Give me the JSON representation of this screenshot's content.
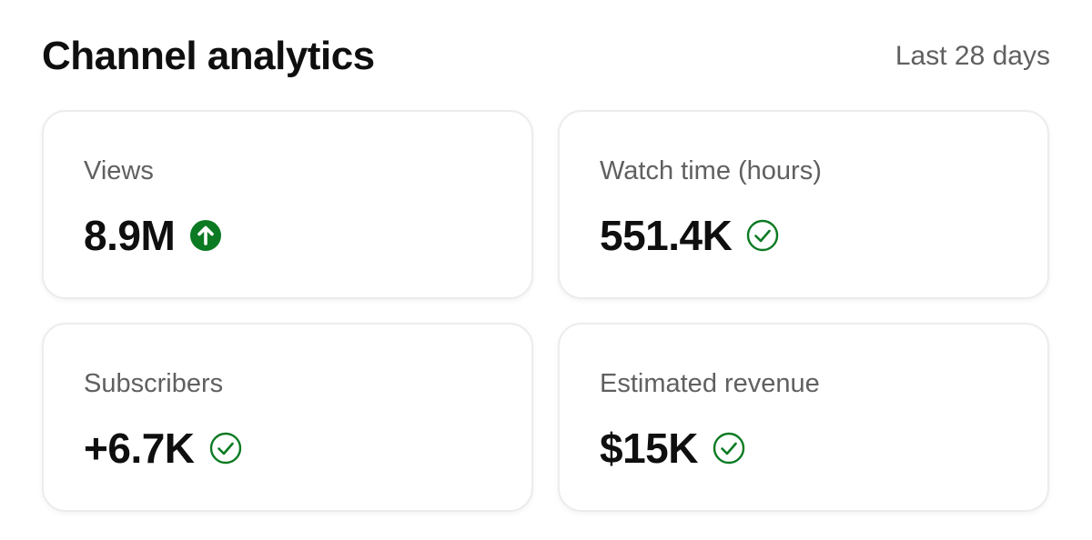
{
  "header": {
    "title": "Channel analytics",
    "period": "Last 28 days"
  },
  "colors": {
    "positive_green": "#0b7a22",
    "label_gray": "#606060",
    "value_black": "#0f0f0f",
    "card_border": "#ececec"
  },
  "cards": [
    {
      "label": "Views",
      "value": "8.9M",
      "status_icon": "arrow-up-circle-icon"
    },
    {
      "label": "Watch time (hours)",
      "value": "551.4K",
      "status_icon": "check-circle-icon"
    },
    {
      "label": "Subscribers",
      "value": "+6.7K",
      "status_icon": "check-circle-icon"
    },
    {
      "label": "Estimated revenue",
      "value": "$15K",
      "status_icon": "check-circle-icon"
    }
  ]
}
